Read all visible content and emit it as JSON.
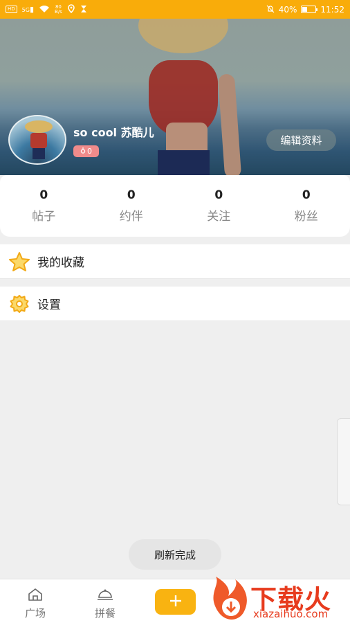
{
  "status_bar": {
    "hd": "HD",
    "signal": "5G",
    "net_speed_top": "80",
    "net_speed_bottom": "B/s",
    "battery": "40%",
    "time": "11:52"
  },
  "profile": {
    "username": "so cool 苏酷儿",
    "gender_count": "0",
    "edit_button": "编辑资料"
  },
  "stats": [
    {
      "value": "0",
      "label": "帖子"
    },
    {
      "value": "0",
      "label": "约伴"
    },
    {
      "value": "0",
      "label": "关注"
    },
    {
      "value": "0",
      "label": "粉丝"
    }
  ],
  "menu": {
    "favorites": "我的收藏",
    "settings": "设置"
  },
  "toast": "刷新完成",
  "bottom_nav": {
    "plaza": "广场",
    "group_meal": "拼餐",
    "add": "+"
  },
  "watermark": {
    "title": "下载火",
    "domain": "xiazaihuo.com"
  },
  "colors": {
    "accent": "#f9ac0a",
    "add_button": "#f9b311",
    "badge": "#f08b8b",
    "watermark": "#e73b1e"
  }
}
